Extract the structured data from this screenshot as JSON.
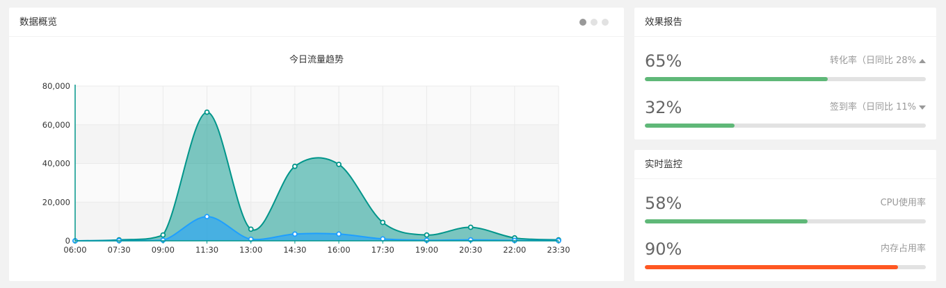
{
  "overview": {
    "title": "数据概览",
    "carousel_count": 3,
    "carousel_active": 0
  },
  "chart_data": {
    "type": "area",
    "title": "今日流量趋势",
    "x": [
      "06:00",
      "07:30",
      "09:00",
      "11:30",
      "13:00",
      "14:30",
      "16:00",
      "17:30",
      "19:00",
      "20:30",
      "22:00",
      "23:30"
    ],
    "series": [
      {
        "values": [
          0,
          500,
          3000,
          66500,
          6000,
          38500,
          39500,
          9500,
          3000,
          7000,
          1500,
          500
        ],
        "color": "#00958a"
      },
      {
        "values": [
          0,
          100,
          300,
          12500,
          800,
          3500,
          3500,
          1000,
          300,
          500,
          200,
          100
        ],
        "color": "#1e9fff"
      }
    ],
    "ylim": [
      0,
      80000
    ],
    "yticks": [
      "0",
      "20,000",
      "40,000",
      "60,000",
      "80,000"
    ],
    "grid": true
  },
  "report": {
    "title": "效果报告",
    "items": [
      {
        "pct": "65%",
        "label": "转化率（日同比 28%",
        "trend": "up",
        "value": 0.65,
        "color": "#5fb878"
      },
      {
        "pct": "32%",
        "label": "签到率（日同比 11%",
        "trend": "down",
        "value": 0.32,
        "color": "#5fb878"
      }
    ]
  },
  "monitor": {
    "title": "实时监控",
    "items": [
      {
        "pct": "58%",
        "label": "CPU使用率",
        "value": 0.58,
        "color": "#5fb878"
      },
      {
        "pct": "90%",
        "label": "内存占用率",
        "value": 0.9,
        "color": "#ff5722"
      }
    ]
  }
}
